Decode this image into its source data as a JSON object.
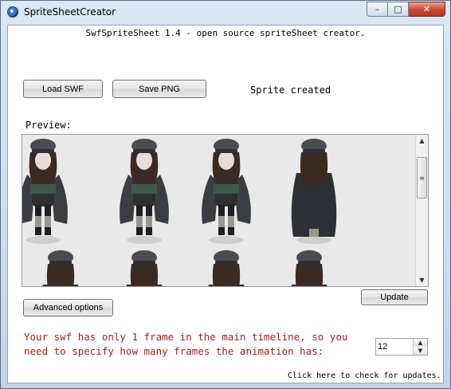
{
  "window": {
    "title": "SpriteSheetCreator",
    "icon": "app-globe-icon",
    "minimize": "–",
    "maximize": "□",
    "close": "✕"
  },
  "header": {
    "text": "SwfSpriteSheet 1.4 - open source spriteSheet creator."
  },
  "toolbar": {
    "load_label": "Load SWF",
    "save_label": "Save PNG",
    "status": "Sprite created"
  },
  "preview": {
    "label": "Preview:",
    "frames_visible_row1": 4,
    "frames_visible_row2": 4
  },
  "actions": {
    "advanced_label": "Advanced options",
    "update_label": "Update"
  },
  "frames": {
    "message_line1": "Your swf has only 1 frame in the main timeline, so you",
    "message_line2": "need to specify how many frames the animation has:",
    "value": "12"
  },
  "footer": {
    "update_link": "Click here to check for updates."
  },
  "colors": {
    "message": "#9b1f1f",
    "preview_bg": "#e9e9e9",
    "titlebar": "#c9d8ea",
    "close": "#c9462d"
  }
}
